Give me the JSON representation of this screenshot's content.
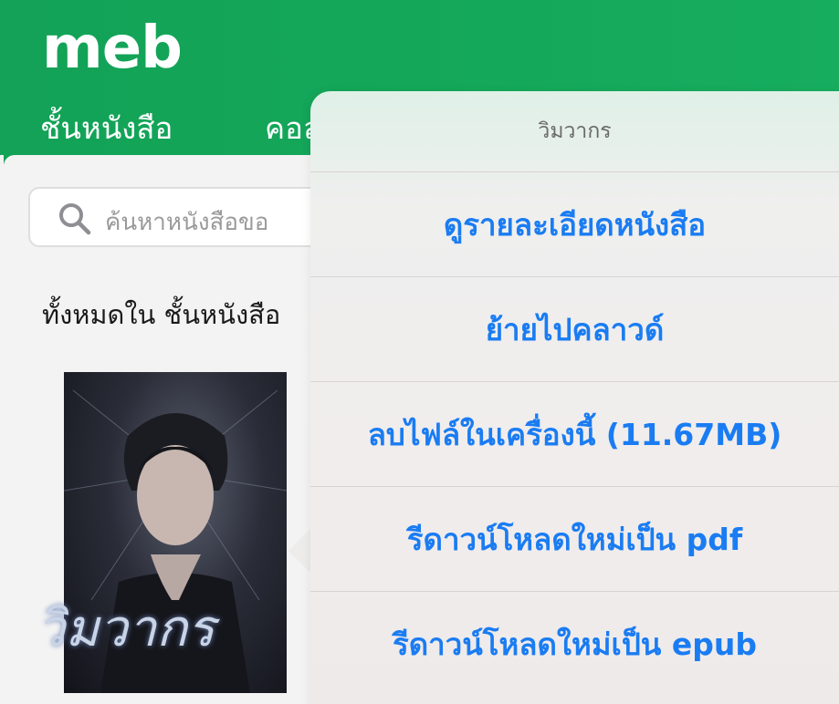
{
  "app": {
    "logo": "meb"
  },
  "tabs": [
    {
      "label": "ชั้นหนังสือ"
    },
    {
      "label": "คอล"
    }
  ],
  "search": {
    "placeholder": "ค้นหาหนังสือขอ"
  },
  "section": {
    "title": "ทั้งหมดใน ชั้นหนังสือ"
  },
  "book": {
    "cover_title": "วิมวากร"
  },
  "menu": {
    "title": "วิมวากร",
    "items": [
      {
        "label": "ดูรายละเอียดหนังสือ"
      },
      {
        "label": "ย้ายไปคลาวด์"
      },
      {
        "label": "ลบไฟล์ในเครื่องนี้ (11.67MB)"
      },
      {
        "label": "รีดาวน์โหลดใหม่เป็น pdf"
      },
      {
        "label": "รีดาวน์โหลดใหม่เป็น epub"
      }
    ]
  },
  "colors": {
    "header_green": "#14a85a",
    "action_blue": "#1a7cf2"
  }
}
